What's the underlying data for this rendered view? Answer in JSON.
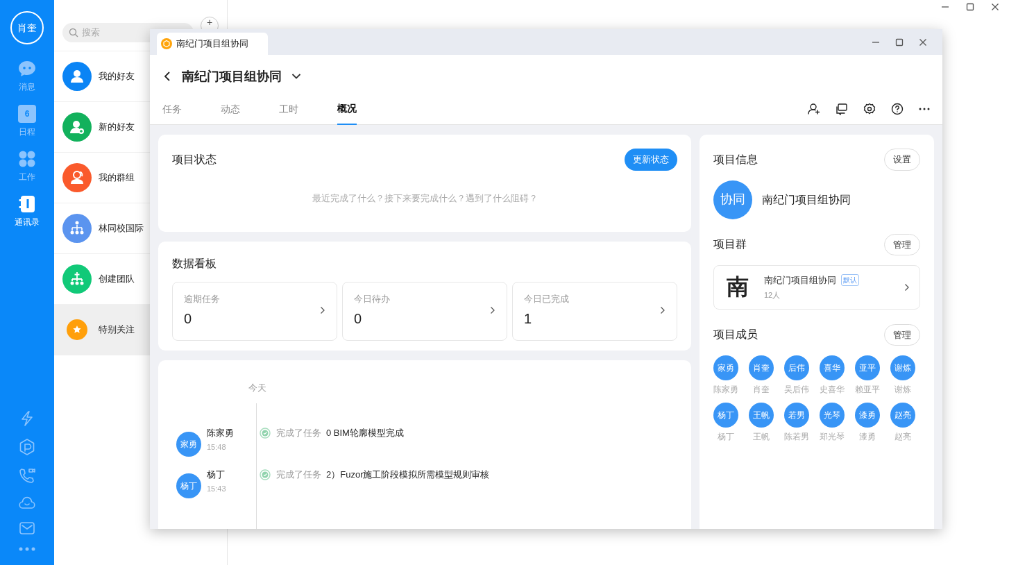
{
  "app_sidebar": {
    "user_avatar": "肖奎",
    "nav": [
      {
        "label": "消息",
        "selected": false
      },
      {
        "label": "日程",
        "selected": false,
        "icon_text": "6"
      },
      {
        "label": "工作",
        "selected": false
      },
      {
        "label": "通讯录",
        "selected": true
      }
    ]
  },
  "contacts": {
    "search": {
      "placeholder": "搜索"
    },
    "add_button": "+",
    "items": [
      {
        "label": "我的好友",
        "color": "#0a84f5",
        "selected": false
      },
      {
        "label": "新的好友",
        "color": "#12b15c",
        "selected": false
      },
      {
        "label": "我的群组",
        "color": "#fa5a2c",
        "selected": false
      },
      {
        "label": "林同校国际",
        "color": "#5b94ef",
        "selected": false
      },
      {
        "label": "创建团队",
        "color": "#11c978",
        "selected": false
      },
      {
        "label": "特别关注",
        "color": "#ff9f0a",
        "selected": true
      }
    ]
  },
  "window": {
    "tab_title": "南纪门项目组协同",
    "title": "南纪门项目组协同",
    "tabs": [
      {
        "label": "任务",
        "selected": false
      },
      {
        "label": "动态",
        "selected": false
      },
      {
        "label": "工时",
        "selected": false
      },
      {
        "label": "概况",
        "selected": true
      }
    ]
  },
  "status_card": {
    "title": "项目状态",
    "button": "更新状态",
    "placeholder": "最近完成了什么？接下来要完成什么？遇到了什么阻碍？"
  },
  "data_board": {
    "title": "数据看板",
    "stats": [
      {
        "label": "逾期任务",
        "value": "0"
      },
      {
        "label": "今日待办",
        "value": "0"
      },
      {
        "label": "今日已完成",
        "value": "1"
      }
    ]
  },
  "timeline": {
    "date": "今天",
    "entries": [
      {
        "avatar": "家勇",
        "name": "陈家勇",
        "time": "15:48",
        "action": "完成了任务",
        "task": "0 BIM轮廓模型完成"
      },
      {
        "avatar": "杨丁",
        "name": "杨丁",
        "time": "15:43",
        "action": "完成了任务",
        "task": "2）Fuzor施工阶段模拟所需模型规则审核"
      }
    ]
  },
  "project_info": {
    "title": "项目信息",
    "button": "设置",
    "avatar": "协同",
    "name": "南纪门项目组协同"
  },
  "project_group": {
    "title": "项目群",
    "button": "管理",
    "logo": "南",
    "name": "南纪门项目组协同",
    "badge": "默认",
    "count": "12人"
  },
  "members": {
    "title": "项目成员",
    "button": "管理",
    "items": [
      {
        "avatar": "家勇",
        "name": "陈家勇"
      },
      {
        "avatar": "肖奎",
        "name": "肖奎"
      },
      {
        "avatar": "后伟",
        "name": "吴后伟"
      },
      {
        "avatar": "喜华",
        "name": "史喜华"
      },
      {
        "avatar": "亚平",
        "name": "赖亚平"
      },
      {
        "avatar": "谢炼",
        "name": "谢炼"
      },
      {
        "avatar": "杨丁",
        "name": "杨丁"
      },
      {
        "avatar": "王帆",
        "name": "王帆"
      },
      {
        "avatar": "若男",
        "name": "陈若男"
      },
      {
        "avatar": "光琴",
        "name": "郑光琴"
      },
      {
        "avatar": "漆勇",
        "name": "漆勇"
      },
      {
        "avatar": "赵亮",
        "name": "赵亮"
      }
    ]
  }
}
